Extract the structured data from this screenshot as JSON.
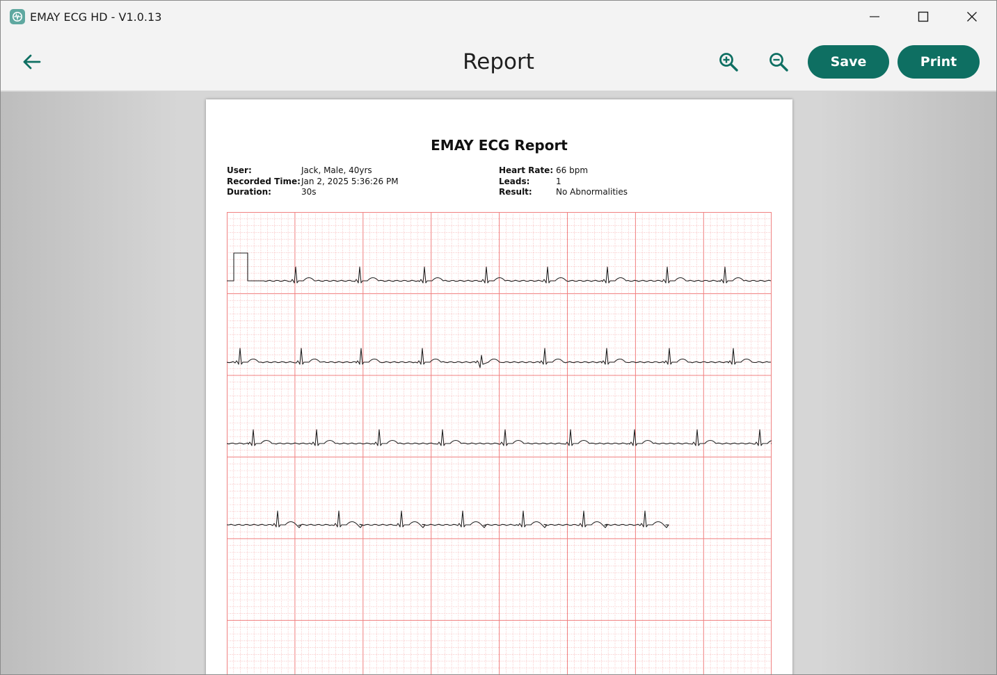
{
  "window": {
    "title": "EMAY ECG HD - V1.0.13",
    "controls": [
      "minimize-icon",
      "maximize-icon",
      "close-icon"
    ]
  },
  "header": {
    "title": "Report",
    "back_icon": "arrow-left-icon",
    "zoom_in_icon": "zoom-in-icon",
    "zoom_out_icon": "zoom-out-icon",
    "save_label": "Save",
    "print_label": "Print",
    "accent_color": "#0e6f62"
  },
  "report": {
    "title": "EMAY ECG Report",
    "left": [
      {
        "label": "User:",
        "value": "Jack,  Male,  40yrs"
      },
      {
        "label": "Recorded Time:",
        "value": "Jan 2,  2025  5:36:26 PM"
      },
      {
        "label": "Duration:",
        "value": "30s"
      }
    ],
    "right": [
      {
        "label": "Heart Rate:",
        "value": "66 bpm"
      },
      {
        "label": "Leads:",
        "value": "1"
      },
      {
        "label": "Result:",
        "value": "No Abnormalities"
      }
    ],
    "grid_color": "#f08080",
    "trace_color": "#222222"
  }
}
